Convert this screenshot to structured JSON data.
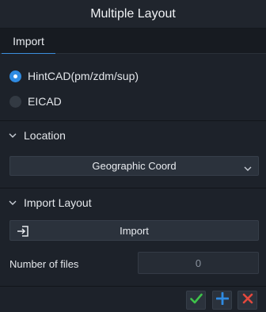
{
  "window": {
    "title": "Multiple Layout"
  },
  "tabs": [
    {
      "label": "Import",
      "active": true
    }
  ],
  "format": {
    "options": [
      {
        "label": "HintCAD(pm/zdm/sup)",
        "selected": true
      },
      {
        "label": "EICAD",
        "selected": false
      }
    ]
  },
  "location": {
    "title": "Location",
    "selected": "Geographic Coord"
  },
  "import_layout": {
    "title": "Import Layout",
    "button_label": "Import",
    "files_label": "Number of files",
    "files_value": "0"
  },
  "colors": {
    "accent": "#2f8be2",
    "confirm": "#3ec24a",
    "add": "#2f8be2",
    "cancel": "#e2483d"
  },
  "icons": {
    "expand": "chevron-down-icon",
    "import": "import-icon",
    "ok": "checkmark-icon",
    "add": "plus-icon",
    "close": "close-icon"
  }
}
